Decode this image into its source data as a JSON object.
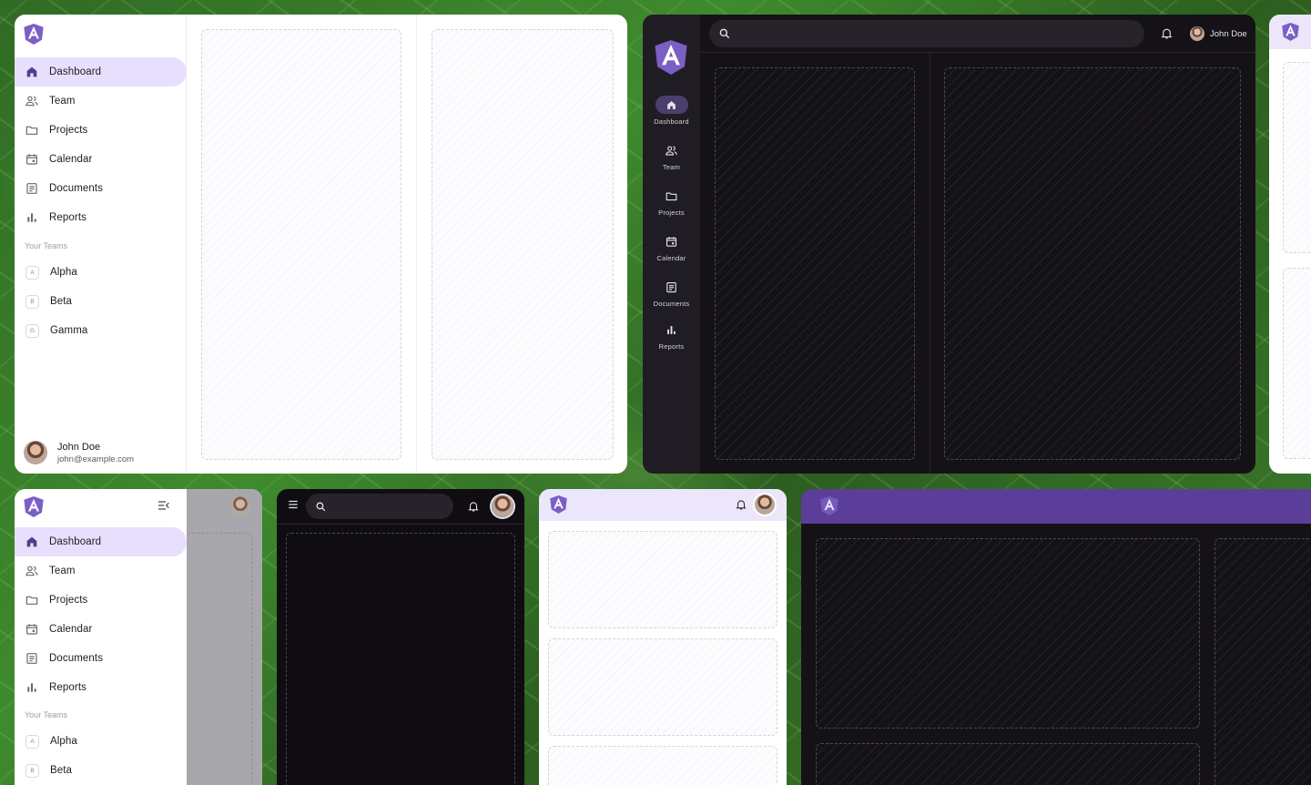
{
  "colors": {
    "accent": "#e8dffc",
    "brand_purple": "#7a5fc4",
    "dark_bg": "#141217",
    "header_purple": "#5b3e9a"
  },
  "nav": [
    {
      "label": "Dashboard",
      "icon": "home-icon",
      "active": true
    },
    {
      "label": "Team",
      "icon": "team-icon"
    },
    {
      "label": "Projects",
      "icon": "folder-icon"
    },
    {
      "label": "Calendar",
      "icon": "calendar-icon"
    },
    {
      "label": "Documents",
      "icon": "document-icon"
    },
    {
      "label": "Reports",
      "icon": "bar-chart-icon"
    }
  ],
  "teams_heading": "Your Teams",
  "teams": [
    {
      "initial": "A",
      "label": "Alpha"
    },
    {
      "initial": "B",
      "label": "Beta"
    },
    {
      "initial": "G",
      "label": "Gamma"
    }
  ],
  "user": {
    "name": "John Doe",
    "email": "john@example.com"
  },
  "search": {
    "placeholder": ""
  }
}
